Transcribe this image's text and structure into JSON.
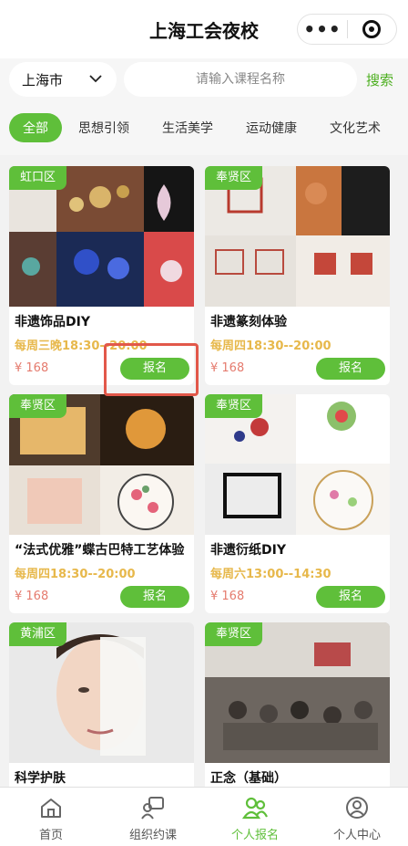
{
  "header": {
    "title": "上海工会夜校",
    "menu_glyph": "•••"
  },
  "search": {
    "city": "上海市",
    "placeholder": "请输入课程名称",
    "button": "搜索"
  },
  "categories": [
    {
      "label": "全部",
      "active": true
    },
    {
      "label": "思想引领",
      "active": false
    },
    {
      "label": "生活美学",
      "active": false
    },
    {
      "label": "运动健康",
      "active": false
    },
    {
      "label": "文化艺术",
      "active": false
    }
  ],
  "courses": [
    {
      "district": "虹口区",
      "name": "非遗饰品DIY",
      "time": "每周三晚18:30--20:00",
      "price": "¥ 168",
      "button": "报名"
    },
    {
      "district": "奉贤区",
      "name": "非遗篆刻体验",
      "time": "每周四18:30--20:00",
      "price": "¥ 168",
      "button": "报名"
    },
    {
      "district": "奉贤区",
      "name": "“法式优雅”蝶古巴特工艺体验",
      "time": "每周四18:30--20:00",
      "price": "¥ 168",
      "button": "报名"
    },
    {
      "district": "奉贤区",
      "name": "非遗衍纸DIY",
      "time": "每周六13:00--14:30",
      "price": "¥ 168",
      "button": "报名"
    },
    {
      "district": "黄浦区",
      "name": "科学护肤",
      "time": "",
      "price": "",
      "button": ""
    },
    {
      "district": "奉贤区",
      "name": "正念（基础）",
      "time": "",
      "price": "",
      "button": ""
    }
  ],
  "tabs": [
    {
      "label": "首页",
      "icon": "home-icon",
      "active": false
    },
    {
      "label": "组织约课",
      "icon": "group-chat-icon",
      "active": false
    },
    {
      "label": "个人报名",
      "icon": "people-icon",
      "active": true
    },
    {
      "label": "个人中心",
      "icon": "user-icon",
      "active": false
    }
  ],
  "colors": {
    "accent": "#5fbf3a",
    "time": "#e7b84b",
    "price": "#e57b6e",
    "highlight": "#e2584a"
  }
}
